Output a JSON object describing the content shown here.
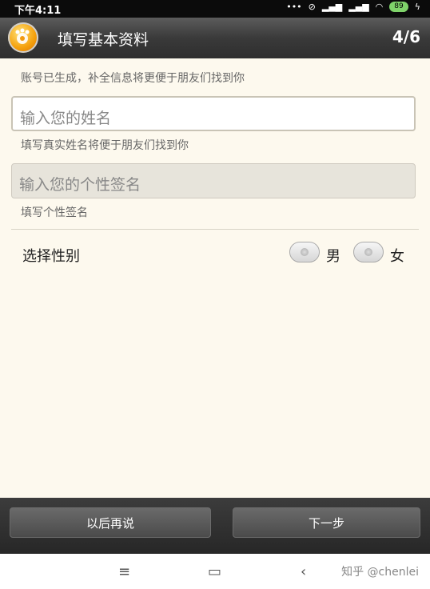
{
  "status": {
    "time": "下午4:11",
    "signal_text": "•••",
    "battery": "89"
  },
  "header": {
    "title": "填写基本资料",
    "step": "4/6"
  },
  "form": {
    "account_hint": "账号已生成，补全信息将更便于朋友们找到你",
    "name_placeholder": "输入您的姓名",
    "name_hint": "填写真实姓名将便于朋友们找到你",
    "signature_placeholder": "输入您的个性签名",
    "signature_hint": "填写个性签名",
    "gender_label": "选择性别",
    "male": "男",
    "female": "女"
  },
  "buttons": {
    "later": "以后再说",
    "next": "下一步"
  },
  "nav": {
    "menu": "≡",
    "home": "▭",
    "back": "‹"
  },
  "watermark": "知乎 @chenlei"
}
